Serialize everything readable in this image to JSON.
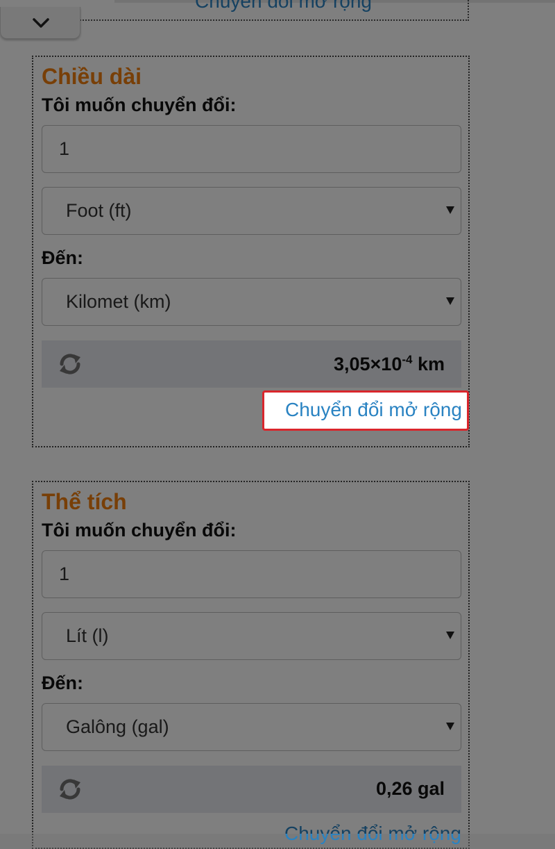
{
  "collapse_tab": {
    "icon": "chevron-down-icon"
  },
  "prev_section": {
    "expand_link": "Chuyển đổi mở rộng"
  },
  "length": {
    "title": "Chiều dài",
    "convert_label": "Tôi muốn chuyển đổi:",
    "amount": "1",
    "from_unit": "Foot (ft)",
    "to_label": "Đến:",
    "to_unit": "Kilomet (km)",
    "result_mantissa": "3,05×10",
    "result_exponent": "-4",
    "result_unit": " km",
    "expand_link": "Chuyển đổi mở rộng"
  },
  "volume": {
    "title": "Thể tích",
    "convert_label": "Tôi muốn chuyển đổi:",
    "amount": "1",
    "from_unit": "Lít (l)",
    "to_label": "Đến:",
    "to_unit": "Galông (gal)",
    "result": "0,26 gal",
    "expand_link": "Chuyển đổi mở rộng"
  },
  "colors": {
    "title_orange": "#f07e0f",
    "link_blue": "#2a83c2",
    "highlight_red": "#d9262c",
    "result_bg": "#e7e9ee"
  }
}
